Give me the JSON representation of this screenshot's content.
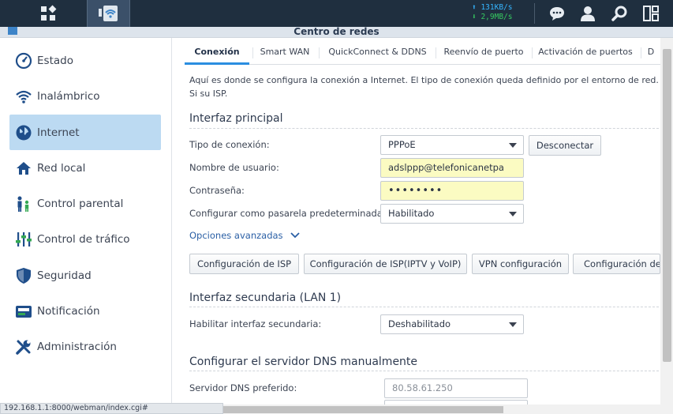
{
  "topbar": {
    "speed_up": "131KB/s",
    "speed_down": "2,9MB/s",
    "icons": [
      "main-menu-icon",
      "network-center-app-icon",
      "chat-icon",
      "user-icon",
      "search-icon",
      "widgets-icon"
    ]
  },
  "window": {
    "title": "Centro de redes"
  },
  "sidebar": {
    "items": [
      {
        "label": "Estado",
        "icon": "gauge-icon"
      },
      {
        "label": "Inalámbrico",
        "icon": "wifi-icon"
      },
      {
        "label": "Internet",
        "icon": "globe-icon",
        "active": true
      },
      {
        "label": "Red local",
        "icon": "house-icon"
      },
      {
        "label": "Control parental",
        "icon": "family-icon"
      },
      {
        "label": "Control de tráfico",
        "icon": "sliders-icon"
      },
      {
        "label": "Seguridad",
        "icon": "shield-icon"
      },
      {
        "label": "Notificación",
        "icon": "notification-icon"
      },
      {
        "label": "Administración",
        "icon": "tools-icon"
      }
    ]
  },
  "tabs": [
    "Conexión",
    "Smart WAN",
    "QuickConnect & DDNS",
    "Reenvío de puerto",
    "Activación de puertos",
    "D"
  ],
  "description": "Aquí es donde se configura la conexión a Internet. El tipo de conexión queda definido por el entorno de red. Si su ISP.",
  "primary": {
    "title": "Interfaz principal",
    "connection_type_label": "Tipo de conexión:",
    "connection_type_value": "PPPoE",
    "disconnect_label": "Desconectar",
    "username_label": "Nombre de usuario:",
    "username_value": "adslppp@telefonicanetpa",
    "password_label": "Contraseña:",
    "password_value": "••••••••",
    "gateway_label": "Configurar como pasarela predeterminada:",
    "gateway_value": "Habilitado",
    "advanced_label": "Opciones avanzadas",
    "buttons": [
      "Configuración de ISP",
      "Configuración de ISP(IPTV y VoIP)",
      "VPN configuración",
      "Configuración de I"
    ]
  },
  "secondary": {
    "title": "Interfaz secundaria (LAN 1)",
    "enable_label": "Habilitar interfaz secundaria:",
    "enable_value": "Deshabilitado"
  },
  "dns": {
    "title": "Configurar el servidor DNS manualmente",
    "preferred_label": "Servidor DNS preferido:",
    "preferred_value": "80.58.61.250"
  },
  "statusbar": {
    "url": "192.168.1.1:8000/webman/index.cgi#"
  },
  "colors": {
    "topbar": "#1f2f3f",
    "active_item": "#bcdaf2",
    "accent": "#2b8ee0",
    "highlight_field": "#fbfbc2"
  }
}
